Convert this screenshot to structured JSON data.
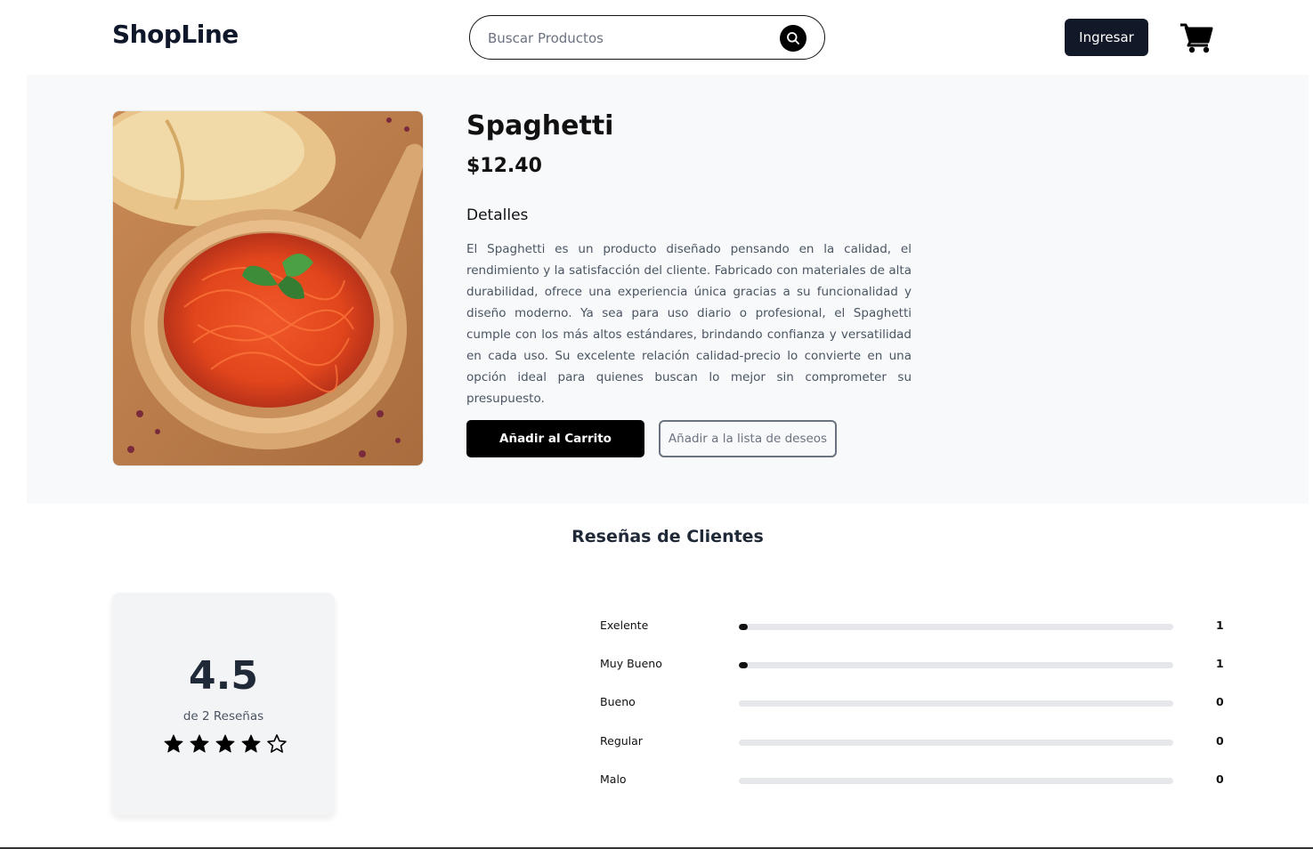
{
  "header": {
    "logo": "ShopLine",
    "search_placeholder": "Buscar Productos",
    "login_label": "Ingresar",
    "icons": {
      "search": "search-icon",
      "cart": "shopping-cart-icon"
    }
  },
  "product": {
    "title": "Spaghetti",
    "price": "$12.40",
    "details_heading": "Detalles",
    "description": "El Spaghetti es un producto diseñado pensando en la calidad, el rendimiento y la satisfacción del cliente. Fabricado con materiales de alta durabilidad, ofrece una experiencia única gracias a su funcionalidad y diseño moderno. Ya sea para uso diario o profesional, el Spaghetti cumple con los más altos estándares, brindando confianza y versatilidad en cada uso. Su excelente relación calidad-precio lo convierte en una opción ideal para quienes buscan lo mejor sin comprometer su presupuesto.",
    "add_to_cart_label": "Añadir al Carrito",
    "wishlist_label": "Añadir a la lista de deseos"
  },
  "reviews": {
    "heading": "Reseñas de Clientes",
    "average": "4.5",
    "count_label": "de 2 Reseñas",
    "stars_filled": 4,
    "stars_total": 5,
    "breakdown": [
      {
        "label": "Exelente",
        "count": "1",
        "fraction": 0.02
      },
      {
        "label": "Muy Bueno",
        "count": "1",
        "fraction": 0.02
      },
      {
        "label": "Bueno",
        "count": "0",
        "fraction": 0
      },
      {
        "label": "Regular",
        "count": "0",
        "fraction": 0
      },
      {
        "label": "Malo",
        "count": "0",
        "fraction": 0
      }
    ]
  },
  "colors": {
    "primary_dark": "#111827",
    "section_bg": "#f8f9fb",
    "bar_track": "#e5e7eb",
    "bar_fill": "#111111"
  }
}
